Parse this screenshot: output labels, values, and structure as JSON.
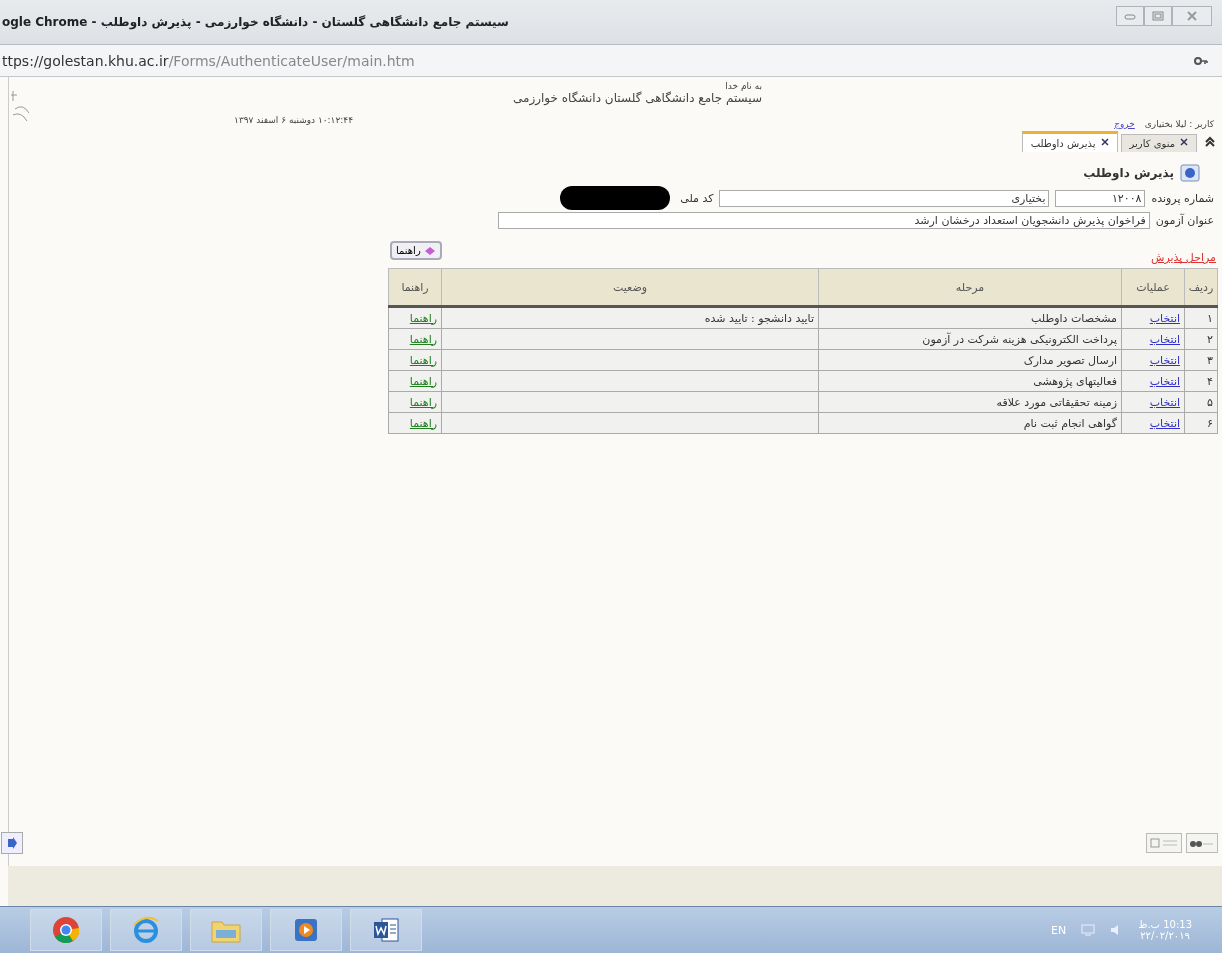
{
  "window": {
    "title": "سیستم جامع دانشگاهی گلستان - دانشگاه خوارزمی - پذیرش داوطلب - ogle Chrome"
  },
  "address_bar": {
    "url_host": "ttps://golestan.khu.ac.ir",
    "url_path": "/Forms/AuthenticateUser/main.htm"
  },
  "header": {
    "bismillah": "به نام خدا",
    "system_name": "سیستم جامع دانشگاهی گلستان   دانشگاه خوارزمی",
    "datetime": "۱۰:۱۲:۴۴ دوشنبه ۶ اسفند ۱۳۹۷",
    "user": "کاربر : لیلا بختیاری",
    "logout": "خروج"
  },
  "tabs": [
    {
      "label": "منوی کاربر",
      "selected": false
    },
    {
      "label": "پذیرش داوطلب",
      "selected": true
    }
  ],
  "form": {
    "heading": "پذیرش داوطلب",
    "file_number_label": "شماره پرونده",
    "file_number": "۱۲۰۰۸",
    "last_name": "بختیاری",
    "national_code_label": "کد ملی",
    "exam_title_label": "عنوان آزمون",
    "exam_title": "فراخوان پذیرش دانشجویان استعداد درخشان ارشد",
    "steps_link": "مراحل پذیرش",
    "help_button": "راهنما"
  },
  "table": {
    "columns": [
      "ردیف",
      "عملیات",
      "مرحله",
      "وضعیت",
      "راهنما"
    ],
    "rows": [
      {
        "index": "۱",
        "action": "انتخاب",
        "stage": "مشخصات داوطلب",
        "status": "تایید دانشجو : تایید شده",
        "help": "راهنما"
      },
      {
        "index": "۲",
        "action": "انتخاب",
        "stage": "پرداخت الکترونیکی هزینه شرکت در آزمون",
        "help": "راهنما"
      },
      {
        "index": "۳",
        "action": "انتخاب",
        "stage": "ارسال تصویر مدارک",
        "help": "راهنما"
      },
      {
        "index": "۴",
        "action": "انتخاب",
        "stage": "فعالیتهای پژوهشی",
        "help": "راهنما"
      },
      {
        "index": "۵",
        "action": "انتخاب",
        "stage": "زمینه تحقیقاتی مورد علاقه",
        "help": "راهنما"
      },
      {
        "index": "۶",
        "action": "انتخاب",
        "stage": "گواهی انجام ثبت نام",
        "help": "راهنما"
      }
    ]
  },
  "taskbar": {
    "language": "EN",
    "time": "10:13 ب.ظ",
    "date": "۲۲/۰۲/۲۰۱۹"
  }
}
